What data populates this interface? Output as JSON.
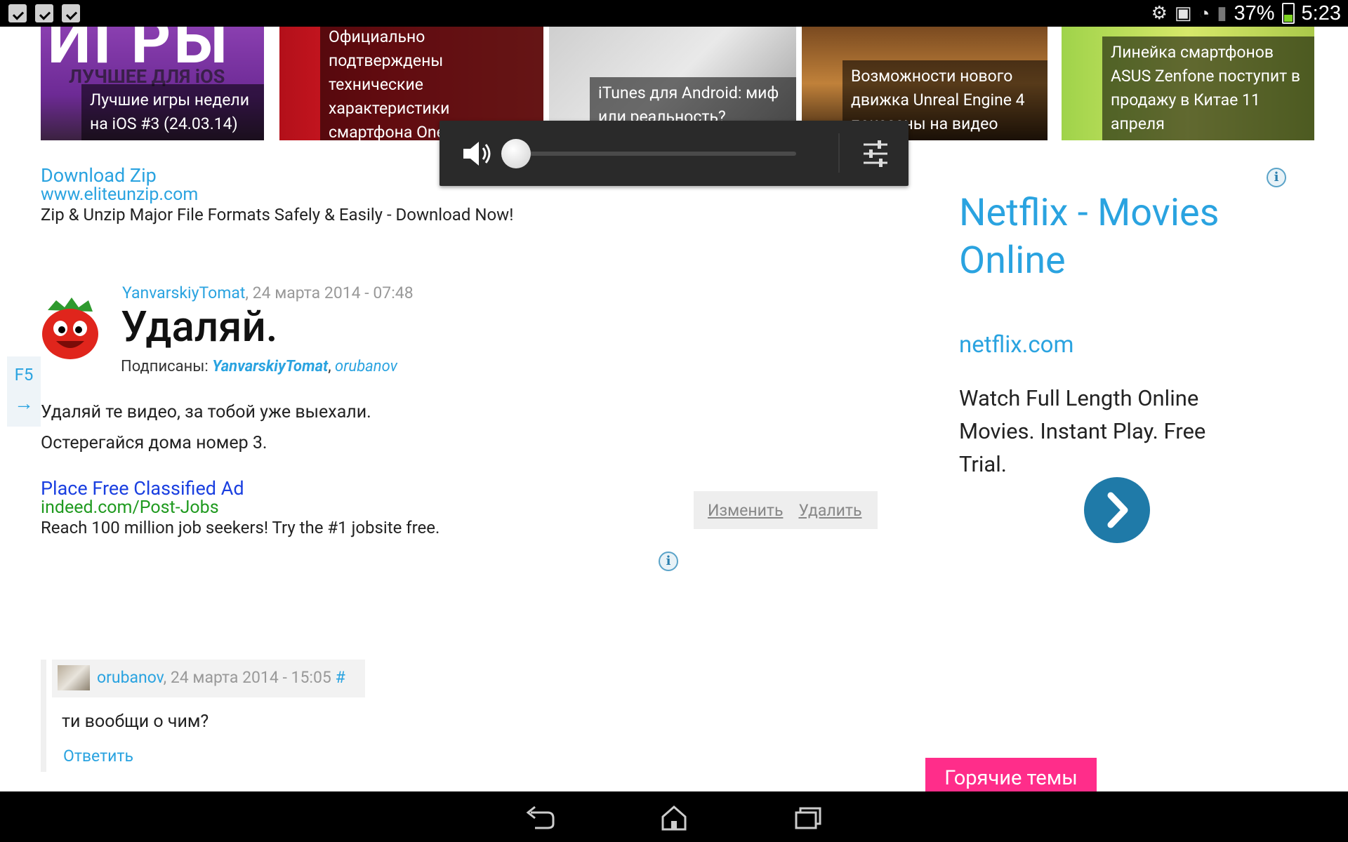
{
  "status_bar": {
    "battery_percent": "37%",
    "clock": "5:23",
    "notification_count": 3
  },
  "news_cards": [
    {
      "caption": "Лучшие игры недели на iOS #3 (24.03.14)",
      "thumb_big": "ИГРЫ",
      "thumb_sub": "ЛУЧШЕЕ ДЛЯ iOS"
    },
    {
      "caption": "Официально подтверждены технические характеристики смартфона OnePlus One"
    },
    {
      "caption": "iTunes для Android: миф или реальность?"
    },
    {
      "caption": "Возможности нового движка Unreal Engine 4 показаны на видео"
    },
    {
      "caption": "Линейка смартфонов ASUS Zenfone поступит в продажу в Китае 11 апреля"
    }
  ],
  "volume": {
    "level": 0.0
  },
  "ad_top": {
    "title": "Download Zip",
    "url": "www.eliteunzip.com",
    "description": "Zip & Unzip Major File Formats Safely & Easily - Download Now!"
  },
  "comment": {
    "author": "YanvarskiyTomat",
    "date": ", 24 марта 2014 - 07:48",
    "title": "Удаляй.",
    "subscribed_label": "Подписаны:",
    "subscribers": [
      "YanvarskiyTomat",
      "orubanov"
    ],
    "body_lines": [
      "Удаляй те видео, за тобой уже выехали.",
      "Остерегайся дома номер 3."
    ],
    "edit_label": "Изменить",
    "delete_label": "Удалить"
  },
  "side_tab": {
    "label": "F5",
    "arrow": "→"
  },
  "ad_bottom": {
    "title": "Place Free Classified Ad",
    "url": "indeed.com/Post-Jobs",
    "description": "Reach 100 million job seekers! Try the #1 jobsite free."
  },
  "reply": {
    "author": "orubanov",
    "date": ", 24 марта 2014 - 15:05",
    "hash": "#",
    "text": "ти вообщи о чим?",
    "reply_label": "Ответить"
  },
  "right_ad": {
    "title": "Netflix - Movies Online",
    "url": "netflix.com",
    "description": "Watch Full Length Online Movies. Instant Play. Free Trial."
  },
  "hot_topics": "Горячие темы",
  "colors": {
    "link": "#2aa3e0",
    "ad_title_blue": "#1a3fe0",
    "ad_url_green": "#1f9a1f",
    "hot_topics_bg": "#ff2d8a"
  }
}
